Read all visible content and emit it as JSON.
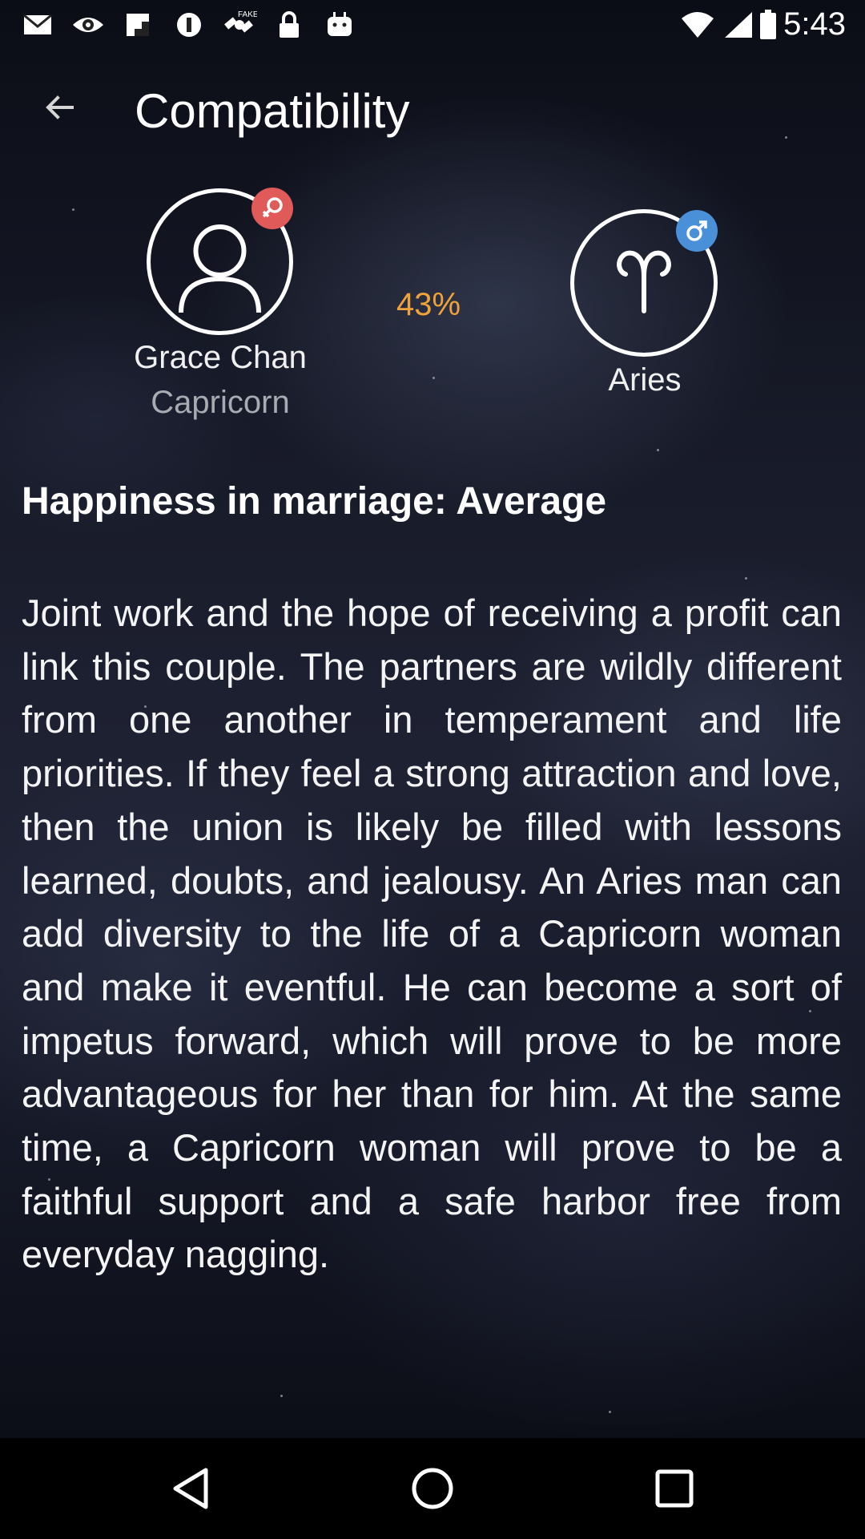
{
  "status_bar": {
    "time": "5:43",
    "icons": [
      "gmail-icon",
      "eye-icon",
      "flipboard-icon",
      "info-icon",
      "satellite-icon",
      "lock-icon",
      "android-icon",
      "wifi-icon",
      "signal-icon",
      "battery-icon"
    ]
  },
  "app_bar": {
    "back_icon": "arrow-left-icon",
    "title": "Compatibility"
  },
  "person_left": {
    "name": "Grace Chan",
    "sign": "Capricorn",
    "avatar_icon": "user-icon",
    "gender_icon": "female-icon",
    "badge_color": "#e05a5a"
  },
  "score": {
    "percent": "43%",
    "value": 43,
    "color": "#f0a33a"
  },
  "person_right": {
    "sign": "Aries",
    "avatar_icon": "aries-symbol-icon",
    "gender_icon": "male-icon",
    "badge_color": "#4a90d9"
  },
  "content": {
    "heading": "Happiness in marriage: Average",
    "body": "Joint work and the hope of receiving a profit can link this couple. The partners are wildly different from one another in temperament and life priorities. If they feel a strong attraction and love, then the union is likely be filled with lessons learned, doubts, and jealousy. An Aries man can add diversity to the life of a Capricorn woman and make it eventful. He can become a sort of impetus forward, which will prove to be more advantageous for her than for him. At the same time, a Capricorn woman will prove to be a faithful support and a safe harbor free from everyday nagging."
  },
  "nav_bar": {
    "back": "back-triangle-icon",
    "home": "home-circle-icon",
    "recents": "recents-square-icon"
  }
}
